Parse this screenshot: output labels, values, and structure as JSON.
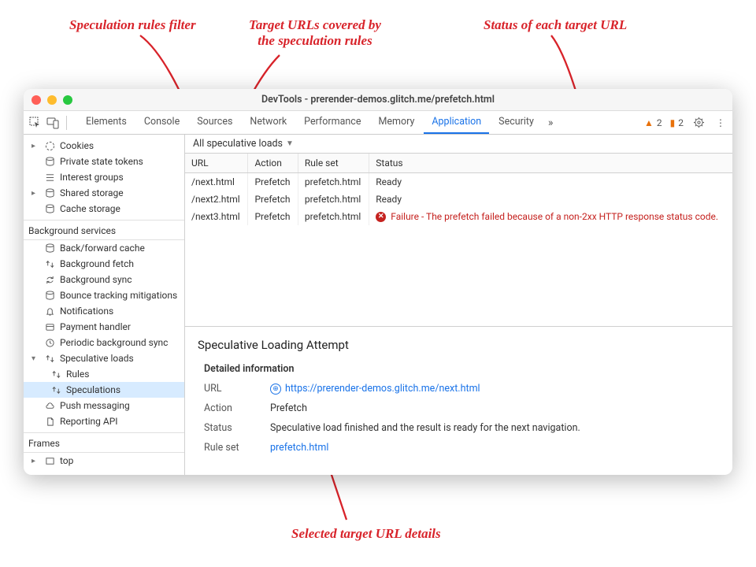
{
  "annotations": {
    "filter": "Speculation rules filter",
    "targets": "Target URLs covered by\nthe speculation rules",
    "status": "Status of each target URL",
    "selected": "Selected target URL details"
  },
  "window": {
    "title": "DevTools - prerender-demos.glitch.me/prefetch.html"
  },
  "tabs": {
    "items": [
      "Elements",
      "Console",
      "Sources",
      "Network",
      "Performance",
      "Memory",
      "Application",
      "Security"
    ],
    "active": "Application",
    "warn_count": "2",
    "flag_count": "2"
  },
  "sidebar": {
    "group1": {
      "items": [
        {
          "icon": "cookie",
          "label": "Cookies",
          "expander": "▸"
        },
        {
          "icon": "db",
          "label": "Private state tokens",
          "expander": ""
        },
        {
          "icon": "list",
          "label": "Interest groups",
          "expander": ""
        },
        {
          "icon": "db",
          "label": "Shared storage",
          "expander": "▸"
        },
        {
          "icon": "db",
          "label": "Cache storage",
          "expander": ""
        }
      ]
    },
    "group2": {
      "title": "Background services",
      "items": [
        {
          "icon": "db",
          "label": "Back/forward cache"
        },
        {
          "icon": "updown",
          "label": "Background fetch"
        },
        {
          "icon": "sync",
          "label": "Background sync"
        },
        {
          "icon": "db",
          "label": "Bounce tracking mitigations"
        },
        {
          "icon": "bell",
          "label": "Notifications"
        },
        {
          "icon": "card",
          "label": "Payment handler"
        },
        {
          "icon": "clock",
          "label": "Periodic background sync"
        },
        {
          "icon": "updown",
          "label": "Speculative loads",
          "expander": "▾",
          "children": [
            {
              "icon": "updown",
              "label": "Rules"
            },
            {
              "icon": "updown",
              "label": "Speculations",
              "selected": true
            }
          ]
        },
        {
          "icon": "cloud",
          "label": "Push messaging"
        },
        {
          "icon": "doc",
          "label": "Reporting API"
        }
      ]
    },
    "frames": {
      "title": "Frames",
      "item": "top",
      "expander": "▸"
    }
  },
  "filter": {
    "label": "All speculative loads"
  },
  "table": {
    "headers": [
      "URL",
      "Action",
      "Rule set",
      "Status"
    ],
    "rows": [
      {
        "url": "/next.html",
        "action": "Prefetch",
        "ruleset": "prefetch.html",
        "status": "Ready",
        "fail": false
      },
      {
        "url": "/next2.html",
        "action": "Prefetch",
        "ruleset": "prefetch.html",
        "status": "Ready",
        "fail": false
      },
      {
        "url": "/next3.html",
        "action": "Prefetch",
        "ruleset": "prefetch.html",
        "status": "Failure - The prefetch failed because of a non-2xx HTTP response status code.",
        "fail": true
      }
    ]
  },
  "detail": {
    "heading": "Speculative Loading Attempt",
    "section": "Detailed information",
    "url_label": "URL",
    "url": "https://prerender-demos.glitch.me/next.html",
    "action_label": "Action",
    "action": "Prefetch",
    "status_label": "Status",
    "status": "Speculative load finished and the result is ready for the next navigation.",
    "ruleset_label": "Rule set",
    "ruleset": "prefetch.html"
  }
}
